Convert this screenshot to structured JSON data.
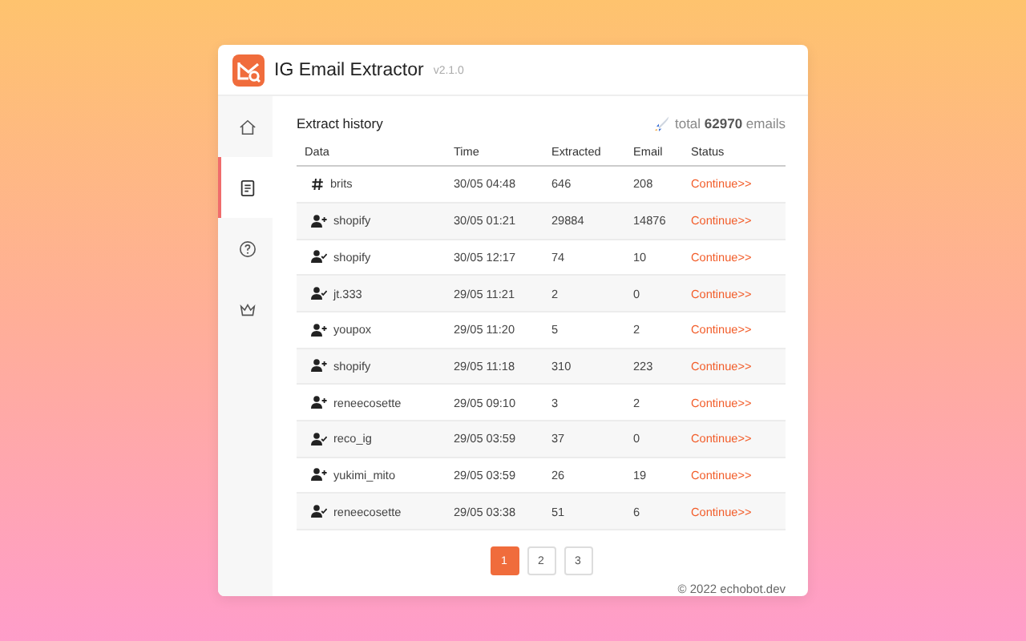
{
  "app": {
    "title": "IG Email Extractor",
    "version": "v2.1.0"
  },
  "sidebar": {
    "items": [
      {
        "kind": "home",
        "selected": false
      },
      {
        "kind": "document",
        "selected": true
      },
      {
        "kind": "help",
        "selected": false
      },
      {
        "kind": "crown",
        "selected": false
      }
    ]
  },
  "history": {
    "title": "Extract history",
    "total_prefix": "total",
    "total": "62970",
    "total_suffix": "emails",
    "columns": [
      "Data",
      "Time",
      "Extracted",
      "Email",
      "Status"
    ],
    "rows": [
      {
        "kind": "hashtag",
        "data": "brits",
        "time": "30/05 04:48",
        "extracted": "646",
        "email": "208",
        "status": "Continue>>"
      },
      {
        "kind": "user-plus",
        "data": "shopify",
        "time": "30/05 01:21",
        "extracted": "29884",
        "email": "14876",
        "status": "Continue>>"
      },
      {
        "kind": "user-check",
        "data": "shopify",
        "time": "30/05 12:17",
        "extracted": "74",
        "email": "10",
        "status": "Continue>>"
      },
      {
        "kind": "user-check",
        "data": "jt.333",
        "time": "29/05 11:21",
        "extracted": "2",
        "email": "0",
        "status": "Continue>>"
      },
      {
        "kind": "user-plus",
        "data": "youpox",
        "time": "29/05 11:20",
        "extracted": "5",
        "email": "2",
        "status": "Continue>>"
      },
      {
        "kind": "user-plus",
        "data": "shopify",
        "time": "29/05 11:18",
        "extracted": "310",
        "email": "223",
        "status": "Continue>>"
      },
      {
        "kind": "user-plus",
        "data": "reneecosette",
        "time": "29/05 09:10",
        "extracted": "3",
        "email": "2",
        "status": "Continue>>"
      },
      {
        "kind": "user-check",
        "data": "reco_ig",
        "time": "29/05 03:59",
        "extracted": "37",
        "email": "0",
        "status": "Continue>>"
      },
      {
        "kind": "user-plus",
        "data": "yukimi_mito",
        "time": "29/05 03:59",
        "extracted": "26",
        "email": "19",
        "status": "Continue>>"
      },
      {
        "kind": "user-check",
        "data": "reneecosette",
        "time": "29/05 03:38",
        "extracted": "51",
        "email": "6",
        "status": "Continue>>"
      }
    ]
  },
  "pagination": [
    {
      "label": "1",
      "selected": true
    },
    {
      "label": "2",
      "selected": false
    },
    {
      "label": "3",
      "selected": false
    }
  ],
  "footer": "© 2022 echobot.dev"
}
